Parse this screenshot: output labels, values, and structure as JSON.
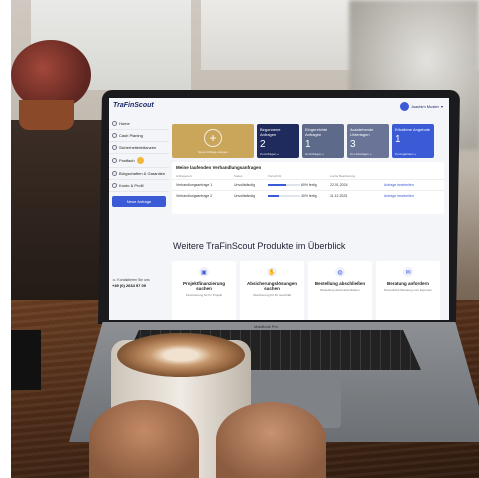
{
  "screen": {
    "logo": "TraFinScout",
    "user_name": "Joachim Muster",
    "sidebar": [
      {
        "label": "Home"
      },
      {
        "label": "Cash Planing"
      },
      {
        "label": "Sicherheitenbilanzen"
      },
      {
        "label": "Postfach",
        "badge": "2"
      },
      {
        "label": "Bürgschaften & Garantien"
      },
      {
        "label": "Konto & Profil"
      }
    ],
    "sidebar_button": "Neue Anfrage",
    "support": {
      "label": "Kontaktieren Sie uns",
      "phone": "+49 (0) 2634 97 09"
    },
    "cards": {
      "new_label": "Neue Anfrage anlegen",
      "items": [
        {
          "title": "Begonnene Anfragen",
          "value": "2",
          "foot": "Zu Anfragen »",
          "color": "#1f2b5c"
        },
        {
          "title": "Eingereichte Anfragen",
          "value": "1",
          "foot": "Zu Anfragen »",
          "color": "#5e6a8a"
        },
        {
          "title": "Ausstehende Unterlagen",
          "value": "3",
          "foot": "Zu Unterlagen »",
          "color": "#6a7496"
        },
        {
          "title": "Erhaltene Angebote",
          "value": "1",
          "foot": "Zu Angeboten »",
          "color": "#3a5ad6"
        }
      ]
    },
    "table": {
      "title": "Meine laufenden Verhandlungsanfragen",
      "headers": [
        "Anfragenart",
        "Status",
        "Fortschritt",
        "Letzte Bearbeitung",
        ""
      ],
      "rows": [
        {
          "type": "Verhandlungsanfrage 1",
          "status": "Unvollständig",
          "progress": 0.55,
          "progress_label": "60% fertig",
          "date": "22.01.2024",
          "action": "Anfrage bearbeiten"
        },
        {
          "type": "Verhandlungsanfrage 2",
          "status": "Unvollständig",
          "progress": 0.35,
          "progress_label": "40% fertig",
          "date": "11.12.2023",
          "action": "Anfrage bearbeiten"
        }
      ]
    },
    "section_title": "Weitere TraFinScout Produkte im Überblick",
    "products": [
      {
        "title": "Projektfinanzierung suchen",
        "desc": "Finanzierung für Ihr Projekt",
        "icon": "box-icon"
      },
      {
        "title": "Absicherungslösungen suchen",
        "desc": "Absicherung für Ihr Geschäft",
        "icon": "hand-icon"
      },
      {
        "title": "Bestellung abschließen",
        "desc": "Bestellung direkt abschließen",
        "icon": "globe-icon"
      },
      {
        "title": "Beratung anfordern",
        "desc": "Persönliche Beratung vom Experten",
        "icon": "chat-icon"
      }
    ]
  },
  "laptop_label": "MacBook Pro"
}
